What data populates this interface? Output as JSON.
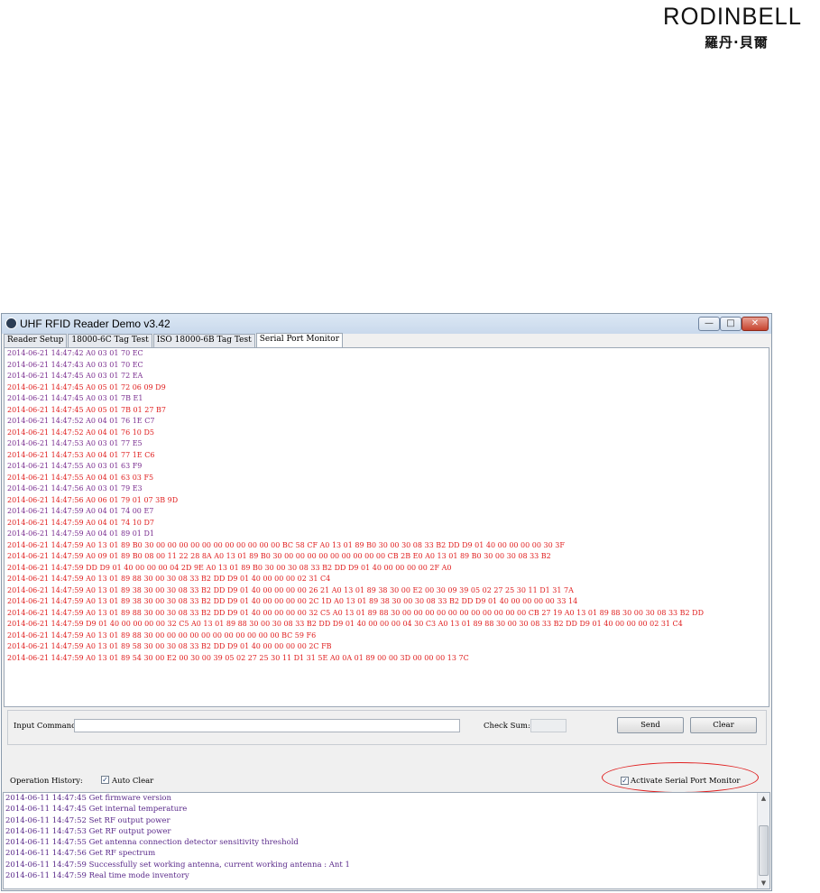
{
  "logo": {
    "wordmark": "RODINBELL",
    "subtitle": "羅丹·貝爾"
  },
  "window": {
    "title": "UHF RFID Reader Demo v3.42",
    "buttons": {
      "minimize": "—",
      "maximize": "□",
      "close": "✕"
    }
  },
  "tabs": [
    "Reader Setup",
    "18000-6C Tag Test",
    "ISO 18000-6B Tag Test",
    "Serial Port Monitor"
  ],
  "active_tab": "Serial Port Monitor",
  "colors": {
    "sent": "#7a2d8f",
    "received": "#e02020",
    "highlight_ellipse": "#e02020"
  },
  "log_lines": [
    {
      "dir": "sent",
      "text": "2014-06-21 14:47:42  A0 03 01 70 EC"
    },
    {
      "dir": "sent",
      "text": "2014-06-21 14:47:43  A0 03 01 70 EC"
    },
    {
      "dir": "sent",
      "text": "2014-06-21 14:47:45  A0 03 01 72 EA"
    },
    {
      "dir": "recv",
      "text": "2014-06-21 14:47:45  A0 05 01 72 06 09 D9"
    },
    {
      "dir": "sent",
      "text": "2014-06-21 14:47:45  A0 03 01 7B E1"
    },
    {
      "dir": "recv",
      "text": "2014-06-21 14:47:45  A0 05 01 7B 01 27 B7"
    },
    {
      "dir": "sent",
      "text": "2014-06-21 14:47:52  A0 04 01 76 1E C7"
    },
    {
      "dir": "recv",
      "text": "2014-06-21 14:47:52  A0 04 01 76 10 D5"
    },
    {
      "dir": "sent",
      "text": "2014-06-21 14:47:53  A0 03 01 77 E5"
    },
    {
      "dir": "recv",
      "text": "2014-06-21 14:47:53  A0 04 01 77 1E C6"
    },
    {
      "dir": "sent",
      "text": "2014-06-21 14:47:55  A0 03 01 63 F9"
    },
    {
      "dir": "recv",
      "text": "2014-06-21 14:47:55  A0 04 01 63 03 F5"
    },
    {
      "dir": "sent",
      "text": "2014-06-21 14:47:56  A0 03 01 79 E3"
    },
    {
      "dir": "recv",
      "text": "2014-06-21 14:47:56  A0 06 01 79 01 07 3B 9D"
    },
    {
      "dir": "sent",
      "text": "2014-06-21 14:47:59  A0 04 01 74 00 E7"
    },
    {
      "dir": "recv",
      "text": "2014-06-21 14:47:59  A0 04 01 74 10 D7"
    },
    {
      "dir": "sent",
      "text": "2014-06-21 14:47:59  A0 04 01 89 01 D1"
    },
    {
      "dir": "recv",
      "text": "2014-06-21 14:47:59  A0 13 01 89 B0 30 00 00 00 00 00 00 00 00 00 00 00 BC 58 CF A0 13 01 89 B0 30 00 30 08 33 B2 DD D9 01 40 00 00 00 00 30 3F"
    },
    {
      "dir": "recv",
      "text": "2014-06-21 14:47:59  A0 09 01 89 B0 08 00 11 22 28 8A A0 13 01 89 B0 30 00 00 00 00 00 00 00 00 00 CB 2B E0 A0 13 01 89 B0 30 00 30 08 33 B2"
    },
    {
      "dir": "recv",
      "text": "2014-06-21 14:47:59  DD D9 01 40 00 00 00 04 2D 9E A0 13 01 89 B0 30 00 30 08 33 B2 DD D9 01 40 00 00 00 00 2F A0"
    },
    {
      "dir": "recv",
      "text": "2014-06-21 14:47:59  A0 13 01 89 88 30 00 30 08 33 B2 DD D9 01 40 00 00 00 02 31 C4"
    },
    {
      "dir": "recv",
      "text": "2014-06-21 14:47:59  A0 13 01 89 38 30 00 30 08 33 B2 DD D9 01 40 00 00 00 00 26 21 A0 13 01 89 38 30 00 E2 00 30 09 39 05 02 27 25 30 11 D1 31 7A"
    },
    {
      "dir": "recv",
      "text": "2014-06-21 14:47:59  A0 13 01 89 38 30 00 30 08 33 B2 DD D9 01 40 00 00 00 00 2C 1D A0 13 01 89 38 30 00 30 08 33 B2 DD D9 01 40 00 00 00 00 33 14"
    },
    {
      "dir": "recv",
      "wrap": true,
      "text": "2014-06-21 14:47:59  A0 13 01 89 88 30 00 30 08 33 B2 DD D9 01 40 00 00 00 00 32 C5 A0 13 01 89 88 30 00 00 00 00 00 00 00 00 00 00 00 CB 27 19 A0 13 01 89 88 30 00 30 08 33 B2 DD"
    },
    {
      "dir": "recv",
      "wrap": true,
      "text": "2014-06-21 14:47:59  D9 01 40 00 00 00 00 32 C5 A0 13 01 89 88 30 00 30 08 33 B2 DD D9 01 40 00 00 00 04 30 C3 A0 13 01 89 88 30 00 30 08 33 B2 DD D9 01 40 00 00 00 02 31 C4"
    },
    {
      "dir": "recv",
      "text": "2014-06-21 14:47:59  A0 13 01 89 88 30 00 00 00 00 00 00 00 00 00 00 00 BC 59 F6"
    },
    {
      "dir": "recv",
      "text": "2014-06-21 14:47:59  A0 13 01 89 58 30 00 30 08 33 B2 DD D9 01 40 00 00 00 00 2C FB"
    },
    {
      "dir": "recv",
      "text": "2014-06-21 14:47:59  A0 13 01 89 54 30 00 E2 00 30 00 39 05 02 27 25 30 11 D1 31 5E A0 0A 01 89 00 00 3D 00 00 00 13 7C"
    }
  ],
  "command": {
    "input_label": "Input Command:",
    "input_value": "",
    "checksum_label": "Check Sum:",
    "checksum_value": "",
    "send_label": "Send",
    "clear_label": "Clear"
  },
  "operation": {
    "history_label": "Operation History:",
    "auto_clear_label": "Auto Clear",
    "auto_clear_checked": true,
    "activate_label": "Activate Serial Port Monitor",
    "activate_checked": true
  },
  "history_lines": [
    "2014-06-11 14:47:45 Get firmware version",
    "2014-06-11 14:47:45 Get internal temperature",
    "2014-06-11 14:47:52 Set RF output power",
    "2014-06-11 14:47:53 Get RF output power",
    "2014-06-11 14:47:55 Get antenna connection detector sensitivity threshold",
    "2014-06-11 14:47:56 Get RF spectrum",
    "2014-06-11 14:47:59 Successfully set working antenna, current working antenna : Ant 1",
    "2014-06-11 14:47:59 Real time mode inventory"
  ]
}
